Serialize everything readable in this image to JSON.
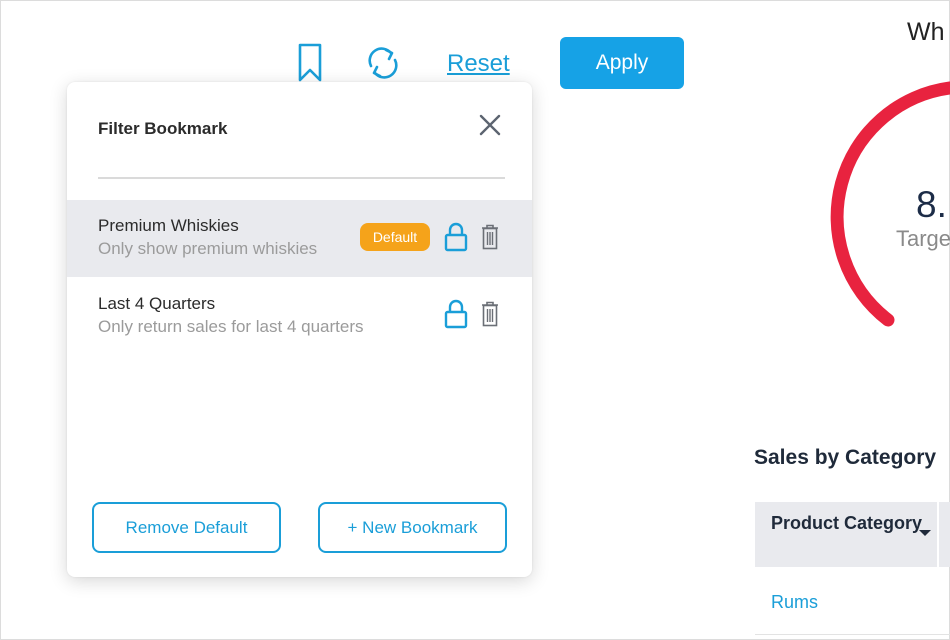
{
  "toolbar": {
    "reset_label": "Reset",
    "apply_label": "Apply",
    "icons": [
      "bookmark-icon",
      "refresh-icon"
    ]
  },
  "background": {
    "title_fragment": "Wh",
    "gauge": {
      "value_fragment": "8.",
      "label_fragment": "Targe",
      "color": "#e8233f"
    },
    "sales_title": "Sales by Category",
    "table": {
      "header": "Product Category",
      "rows": [
        "Rums"
      ]
    }
  },
  "panel": {
    "title": "Filter Bookmark",
    "search_value": "",
    "bookmarks": [
      {
        "name": "Premium Whiskies",
        "description": "Only show premium whiskies",
        "badge": "Default",
        "active": true
      },
      {
        "name": "Last 4 Quarters",
        "description": "Only return sales for last 4 quarters",
        "badge": "",
        "active": false
      }
    ],
    "remove_default_label": "Remove Default",
    "new_bookmark_label": "+ New Bookmark"
  },
  "colors": {
    "accent": "#1a9ed8",
    "apply_bg": "#16a2e6",
    "badge": "#f5a31a",
    "gauge": "#e8233f",
    "active_row": "#e9eaee"
  }
}
